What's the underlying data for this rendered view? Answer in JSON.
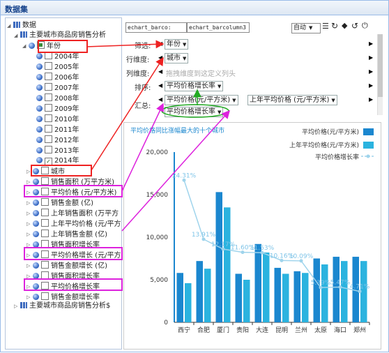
{
  "window": {
    "title": "数据集"
  },
  "tree": {
    "root": "数据",
    "dataset": "主要城市商品房销售分析",
    "dataset2": "主要城市商品房销售分析$",
    "year_field": "年份",
    "years": [
      "2004年",
      "2005年",
      "2006年",
      "2007年",
      "2008年",
      "2009年",
      "2010年",
      "2011年",
      "2012年",
      "2013年",
      "2014年"
    ],
    "fields": [
      "城市",
      "销售面积 (万平方米)",
      "平均价格 (元/平方米)",
      "销售金额 (亿)",
      "上年销售面积 (万平方",
      "上年平均价格 (元/平方",
      "上年销售金额 (亿)",
      "销售面积增长率",
      "平均价格增长 (元/平方",
      "销售金额增长 (亿)",
      "销售面积增长率",
      "平均价格增长率",
      "销售金额增长率"
    ]
  },
  "config": {
    "combo1": "echart_barco:",
    "combo2": "echart_barcolumn3",
    "mode": "自动",
    "filter_label": "筛选:",
    "filter_value": "年份",
    "row_label": "行维度:",
    "row_value": "城市",
    "col_label": "列维度:",
    "col_hint": "拖拽维度到这定义列头",
    "sort_label": "排序:",
    "sort_value": "平均价格增长率",
    "agg_label": "汇总:",
    "agg_values": [
      "平均价格(元/平方米)",
      "上年平均价格 (元/平方米)",
      "平均价格增长率"
    ]
  },
  "chart_data": {
    "type": "bar",
    "title": "平均价格同比涨幅最大的十个城市",
    "categories": [
      "西宁",
      "合肥",
      "厦门",
      "贵阳",
      "大连",
      "昆明",
      "兰州",
      "太原",
      "海口",
      "郑州"
    ],
    "series": [
      {
        "name": "平均价格(元/平方米)",
        "type": "bar",
        "values": [
          5800,
          7200,
          15300,
          5700,
          9200,
          6400,
          6000,
          7500,
          7700,
          7700
        ],
        "color": "#1b87cf"
      },
      {
        "name": "上年平均价格(元/平方米)",
        "type": "bar",
        "values": [
          4600,
          6300,
          13500,
          5000,
          8200,
          5700,
          5800,
          6800,
          7200,
          7200
        ],
        "color": "#2bb3df"
      },
      {
        "name": "平均价格增长率",
        "type": "line",
        "values": [
          24.31,
          13.91,
          12.17,
          11.6,
          11.53,
          10.16,
          10.09,
          5.39,
          5.47,
          4.71
        ],
        "labels": [
          "24.31%",
          "13.91%",
          "12.17%",
          "11.60%",
          "11.53%",
          "10.16%",
          "10.09%",
          "5.39%",
          "5.47%",
          "4.71%"
        ],
        "color": "#9fd4ec"
      }
    ],
    "yticks": [
      0,
      5000,
      10000,
      15000,
      20000
    ],
    "yticks_labels": [
      "0",
      "5,000",
      "10,000",
      "15,000",
      "20,000"
    ],
    "ylim": [
      0,
      20000
    ]
  },
  "colors": {
    "highlight_red": "#ee2222",
    "highlight_magenta": "#dd22dd",
    "highlight_green": "#22aa22"
  }
}
